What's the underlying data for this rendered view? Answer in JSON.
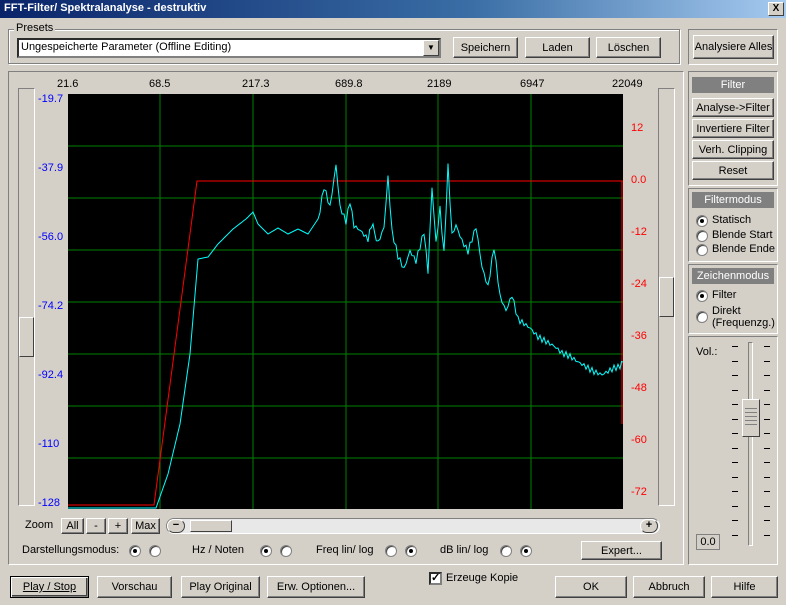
{
  "window": {
    "title": "FFT-Filter/ Spektralanalyse - destruktiv",
    "close_label": "X"
  },
  "presets": {
    "group_label": "Presets",
    "selected": "Ungespeicherte Parameter  (Offline Editing)",
    "save_label": "Speichern",
    "load_label": "Laden",
    "delete_label": "Löschen"
  },
  "analyze_all_label": "Analysiere Alles",
  "graph": {
    "x_ticks": [
      "21.6",
      "68.5",
      "217.3",
      "689.8",
      "2189",
      "6947",
      "22049"
    ],
    "left_ticks": [
      "-19.7",
      "-37.9",
      "-56.0",
      "-74.2",
      "-92.4",
      "-110",
      "-128"
    ],
    "right_ticks": [
      "12",
      "0.0",
      "-12",
      "-24",
      "-36",
      "-48",
      "-60",
      "-72"
    ],
    "colors": {
      "background": "#000000",
      "grid": "#008000",
      "filter": "#ff0000",
      "spectrum": "#00ffff",
      "left_axis": "#0000ff",
      "right_axis": "#ff0000"
    }
  },
  "zoom": {
    "label": "Zoom",
    "all": "All",
    "minus": "-",
    "plus": "+",
    "max": "Max",
    "scroll_left": "−",
    "scroll_right": "+"
  },
  "options": {
    "display_mode": "Darstellungsmodus:",
    "hz_notes": "Hz / Noten",
    "freq_scale": "Freq lin/ log",
    "db_scale": "dB lin/ log",
    "expert": "Expert..."
  },
  "filter_panel": {
    "header": "Filter",
    "buttons": [
      "Analyse->Filter",
      "Invertiere Filter",
      "Verh. Clipping",
      "Reset"
    ]
  },
  "filtermode": {
    "header": "Filtermodus",
    "options": [
      "Statisch",
      "Blende Start",
      "Blende Ende"
    ],
    "selected": "Statisch"
  },
  "drawmode": {
    "header": "Zeichenmodus",
    "options": [
      "Filter",
      "Direkt",
      "(Frequenzg.)"
    ],
    "selected": "Filter"
  },
  "volume": {
    "label": "Vol.:",
    "value": "0.0"
  },
  "bottom": {
    "play_stop": "Play / Stop",
    "preview": "Vorschau",
    "play_original": "Play Original",
    "ext_options": "Erw. Optionen...",
    "create_copy": "Erzeuge Kopie",
    "ok": "OK",
    "cancel": "Abbruch",
    "help": "Hilfe"
  }
}
